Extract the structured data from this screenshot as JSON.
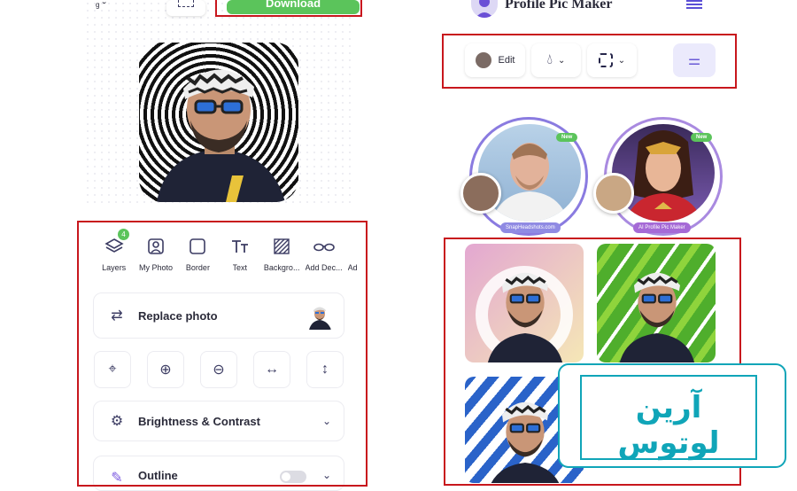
{
  "left_panel": {
    "download_label": "Download",
    "tools": [
      {
        "label": "Layers",
        "icon": "layers-icon",
        "badge": "4"
      },
      {
        "label": "My Photo",
        "icon": "photo-icon"
      },
      {
        "label": "Border",
        "icon": "square-icon"
      },
      {
        "label": "Text",
        "icon": "text-icon"
      },
      {
        "label": "Backgro...",
        "icon": "background-icon"
      },
      {
        "label": "Add Dec...",
        "icon": "glasses-icon"
      },
      {
        "label": "Ad",
        "icon": ""
      }
    ],
    "replace_photo_label": "Replace photo",
    "brightness_label": "Brightness & Contrast",
    "outline_label": "Outline"
  },
  "right_panel": {
    "app_title": "Profile Pic Maker",
    "edit_label": "Edit",
    "badge_new": "New",
    "card1_site": "SnapHeadshots.com",
    "card2_site": "AI Profile Pic Maker"
  },
  "watermark": {
    "text": "آرین لوتوس"
  },
  "colors": {
    "highlight_red": "#c8171d",
    "download_green": "#5bc45b",
    "ring_purple": "#8a7be0",
    "watermark_teal": "#10a5b8"
  }
}
